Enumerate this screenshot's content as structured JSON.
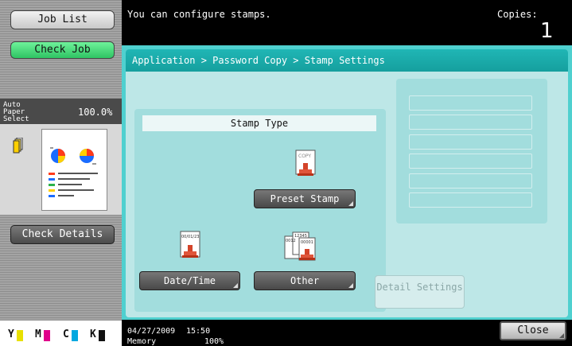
{
  "sidebar": {
    "job_list": "Job List",
    "check_job": "Check Job",
    "paper_source": "Auto Paper Select",
    "zoom": "100.0%",
    "check_details": "Check Details",
    "toner": [
      {
        "label": "Y",
        "color": "#e8e000",
        "level": 0.8
      },
      {
        "label": "M",
        "color": "#e0008a",
        "level": 0.8
      },
      {
        "label": "C",
        "color": "#00a8e0",
        "level": 0.8
      },
      {
        "label": "K",
        "color": "#111111",
        "level": 0.8
      }
    ]
  },
  "header": {
    "message": "You can configure stamps.",
    "copies_label": "Copies:",
    "copies_value": "1"
  },
  "main": {
    "breadcrumb": "Application > Password Copy > Stamp Settings",
    "stamp_type_title": "Stamp Type",
    "preset_stamp": "Preset Stamp",
    "date_time": "Date/Time",
    "other": "Other",
    "detail_settings": "Detail Settings",
    "icons": {
      "preset_icon_text": "COPY",
      "datetime_icon_text": "00/01/23",
      "other_icon_text_1": "12345",
      "other_icon_text_2": "00001",
      "other_icon_text_3": "0012"
    }
  },
  "status": {
    "date": "04/27/2009",
    "time": "15:50",
    "memory_label": "Memory",
    "memory_value": "100%",
    "close": "Close"
  }
}
